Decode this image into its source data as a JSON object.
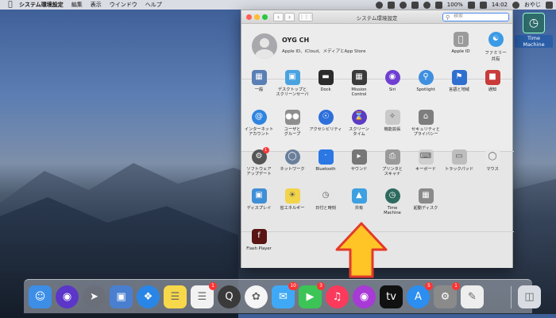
{
  "menubar": {
    "app_name": "システム環境設定",
    "menus": [
      "編集",
      "表示",
      "ウインドウ",
      "ヘルプ"
    ],
    "battery": "100%",
    "time": "14:02",
    "user": "おやじ"
  },
  "desktop": {
    "volume_label": "Time Machine"
  },
  "window": {
    "title": "システム環境設定",
    "search_placeholder": "検索"
  },
  "account": {
    "name": "OYG CH",
    "subtitle": "Apple ID、iCloud、メディアとApp Store",
    "apple_id_label": "Apple ID",
    "family_label": "ファミリー\n共有"
  },
  "rows": [
    [
      {
        "name": "general",
        "label": "一般",
        "icon": "general-icon",
        "color": "#5a7fb5"
      },
      {
        "name": "desktop-screensaver",
        "label": "デスクトップと\nスクリーンセーバ",
        "icon": "desktop-icon",
        "color": "#4aa3e0"
      },
      {
        "name": "dock",
        "label": "Dock",
        "icon": "dock-icon",
        "color": "#2b2b2b"
      },
      {
        "name": "mission-control",
        "label": "Mission\nControl",
        "icon": "mission-control-icon",
        "color": "#3a3a3a"
      },
      {
        "name": "siri",
        "label": "Siri",
        "icon": "siri-icon",
        "color": "#6e3fd1"
      },
      {
        "name": "spotlight",
        "label": "Spotlight",
        "icon": "spotlight-icon",
        "color": "#3f8fe0"
      },
      {
        "name": "language-region",
        "label": "言語と地域",
        "icon": "flag-icon",
        "color": "#2f6fd0"
      },
      {
        "name": "notifications",
        "label": "通知",
        "icon": "notifications-icon",
        "color": "#c93b3b"
      }
    ],
    [
      {
        "name": "internet-accounts",
        "label": "インターネット\nアカウント",
        "icon": "at-icon",
        "color": "#2f84e0"
      },
      {
        "name": "users-groups",
        "label": "ユーザと\nグループ",
        "icon": "users-icon",
        "color": "#8e8e8e"
      },
      {
        "name": "accessibility",
        "label": "アクセシビリティ",
        "icon": "accessibility-icon",
        "color": "#2d6fdb"
      },
      {
        "name": "screen-time",
        "label": "スクリーン\nタイム",
        "icon": "hourglass-icon",
        "color": "#5b3cc4"
      },
      {
        "name": "extensions",
        "label": "機能拡張",
        "icon": "puzzle-icon",
        "color": "#c9c9c9"
      },
      {
        "name": "security-privacy",
        "label": "セキュリティと\nプライバシー",
        "icon": "house-icon",
        "color": "#7e7e7e"
      }
    ],
    [
      {
        "name": "software-update",
        "label": "ソフトウェア\nアップデート",
        "icon": "gear-icon",
        "color": "#555555",
        "badge": "1"
      },
      {
        "name": "network",
        "label": "ネットワーク",
        "icon": "globe-icon",
        "color": "#6a7f9c"
      },
      {
        "name": "bluetooth",
        "label": "Bluetooth",
        "icon": "bluetooth-icon",
        "color": "#2b78e4"
      },
      {
        "name": "sound",
        "label": "サウンド",
        "icon": "speaker-icon",
        "color": "#777777"
      },
      {
        "name": "printers-scanners",
        "label": "プリンタと\nスキャナ",
        "icon": "printer-icon",
        "color": "#9a9a9a"
      },
      {
        "name": "keyboard",
        "label": "キーボード",
        "icon": "keyboard-icon",
        "color": "#cfcfcf"
      },
      {
        "name": "trackpad",
        "label": "トラックパッド",
        "icon": "trackpad-icon",
        "color": "#bdbdbd"
      },
      {
        "name": "mouse",
        "label": "マウス",
        "icon": "mouse-icon",
        "color": "#e8e8e8"
      }
    ],
    [
      {
        "name": "displays",
        "label": "ディスプレイ",
        "icon": "display-icon",
        "color": "#3f8ed6"
      },
      {
        "name": "energy-saver",
        "label": "省エネルギー",
        "icon": "bulb-icon",
        "color": "#f2d44a"
      },
      {
        "name": "date-time",
        "label": "日付と時刻",
        "icon": "clock-icon",
        "color": "#e5e5e5"
      },
      {
        "name": "sharing",
        "label": "共有",
        "icon": "folder-icon",
        "color": "#3ea0e0"
      },
      {
        "name": "time-machine",
        "label": "Time\nMachine",
        "icon": "time-machine-icon",
        "color": "#2e6b5e"
      },
      {
        "name": "startup-disk",
        "label": "起動ディスク",
        "icon": "disk-icon",
        "color": "#8a8a8a"
      }
    ],
    [
      {
        "name": "flash-player",
        "label": "Flash Player",
        "icon": "flash-icon",
        "color": "#5a1414"
      }
    ]
  ],
  "dock": [
    {
      "name": "finder",
      "icon": "finder-icon",
      "color": "#3d8ee6"
    },
    {
      "name": "siri",
      "icon": "siri-icon",
      "color": "#5b36c8"
    },
    {
      "name": "launchpad",
      "icon": "rocket-icon",
      "color": "#6a6f7a"
    },
    {
      "name": "preview",
      "icon": "preview-icon",
      "color": "#4a7fd0"
    },
    {
      "name": "safari",
      "icon": "compass-icon",
      "color": "#2a86e6"
    },
    {
      "name": "notes",
      "icon": "notes-icon",
      "color": "#f7d84b"
    },
    {
      "name": "reminders",
      "icon": "list-icon",
      "color": "#f2f2f2",
      "badge": "1"
    },
    {
      "name": "quicktime",
      "icon": "quicktime-icon",
      "color": "#3a3a3a"
    },
    {
      "name": "photos",
      "icon": "photos-icon",
      "color": "#f5f5f5"
    },
    {
      "name": "messages",
      "icon": "chat-icon",
      "color": "#3fa9f5",
      "badge": "10"
    },
    {
      "name": "facetime",
      "icon": "video-icon",
      "color": "#3cc456",
      "badge": "3"
    },
    {
      "name": "music",
      "icon": "music-icon",
      "color": "#fb3a5c"
    },
    {
      "name": "podcasts",
      "icon": "podcast-icon",
      "color": "#a83ad6"
    },
    {
      "name": "tv",
      "icon": "tv-icon",
      "color": "#111111",
      "text": "tv"
    },
    {
      "name": "app-store",
      "icon": "appstore-icon",
      "color": "#2b8ef0",
      "badge": "5"
    },
    {
      "name": "system-preferences",
      "icon": "gear-icon",
      "color": "#8a8a8a",
      "badge": "1"
    },
    {
      "name": "text-edit",
      "icon": "pen-icon",
      "color": "#eeeeee"
    },
    {
      "name": "trash",
      "icon": "trash-icon",
      "color": "#d9dde3"
    }
  ],
  "annotation": {
    "arrow_color": "#ffc425",
    "arrow_border": "#e23a2a"
  }
}
